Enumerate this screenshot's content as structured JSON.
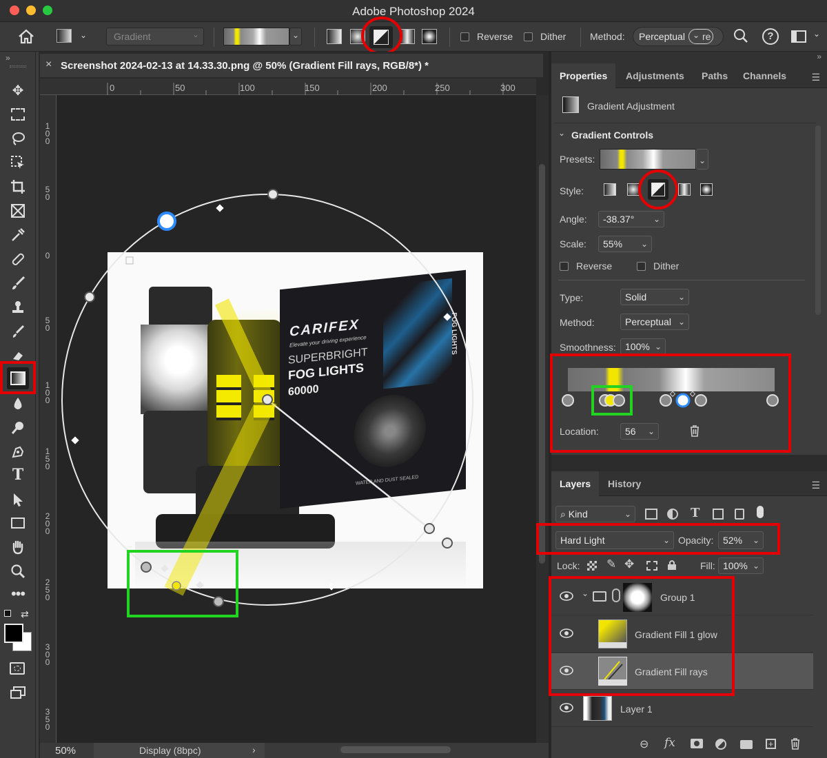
{
  "app": {
    "title": "Adobe Photoshop 2024"
  },
  "options_bar": {
    "tool": "Gradient",
    "reverse_label": "Reverse",
    "dither_label": "Dither",
    "method_label": "Method:",
    "method_value": "Perceptual",
    "method_value_tail": "re"
  },
  "document": {
    "tab_title": "Screenshot 2024-02-13 at 14.33.30.png @ 50% (Gradient Fill rays, RGB/8*) *",
    "zoom": "50%",
    "status": "Display (8bpc)",
    "ruler_top": [
      "0",
      "50",
      "100",
      "150",
      "200",
      "250",
      "300"
    ],
    "ruler_left": [
      "1\n0\n0",
      "5\n0",
      "0",
      "5\n0",
      "1\n0\n0",
      "1\n5\n0",
      "2\n0\n0",
      "2\n5\n0",
      "3\n0\n0",
      "3\n5\n0"
    ],
    "product_box": {
      "brand": "CARIFEX",
      "tagline": "Elevate your driving experience",
      "line1": "SUPERBRIGHT",
      "line2": "FOG LIGHTS",
      "big": "60000",
      "side": "FOG LIGHTS",
      "footer": "WATER AND DUST SEALED"
    }
  },
  "properties": {
    "tabs": [
      "Properties",
      "Adjustments",
      "Paths",
      "Channels"
    ],
    "header": "Gradient Adjustment",
    "section": "Gradient Controls",
    "presets_label": "Presets:",
    "style_label": "Style:",
    "angle_label": "Angle:",
    "angle_value": "-38.37°",
    "scale_label": "Scale:",
    "scale_value": "55%",
    "reverse_label": "Reverse",
    "dither_label": "Dither",
    "type_label": "Type:",
    "type_value": "Solid",
    "method_label": "Method:",
    "method_value": "Perceptual",
    "smoothness_label": "Smoothness:",
    "smoothness_value": "100%",
    "location_label": "Location:",
    "location_value": "56"
  },
  "layers": {
    "tabs": [
      "Layers",
      "History"
    ],
    "kind": "Kind",
    "blend_mode": "Hard Light",
    "opacity_label": "Opacity:",
    "opacity_value": "52%",
    "lock_label": "Lock:",
    "fill_label": "Fill:",
    "fill_value": "100%",
    "items": [
      {
        "name": "Group 1"
      },
      {
        "name": "Gradient Fill 1 glow"
      },
      {
        "name": "Gradient Fill rays"
      },
      {
        "name": "Layer 1"
      }
    ]
  },
  "colors": {
    "highlight_red": "#e40000",
    "highlight_green": "#22d322",
    "gradient_yellow": "#f2e600",
    "accent_blue": "#2e8bff"
  }
}
